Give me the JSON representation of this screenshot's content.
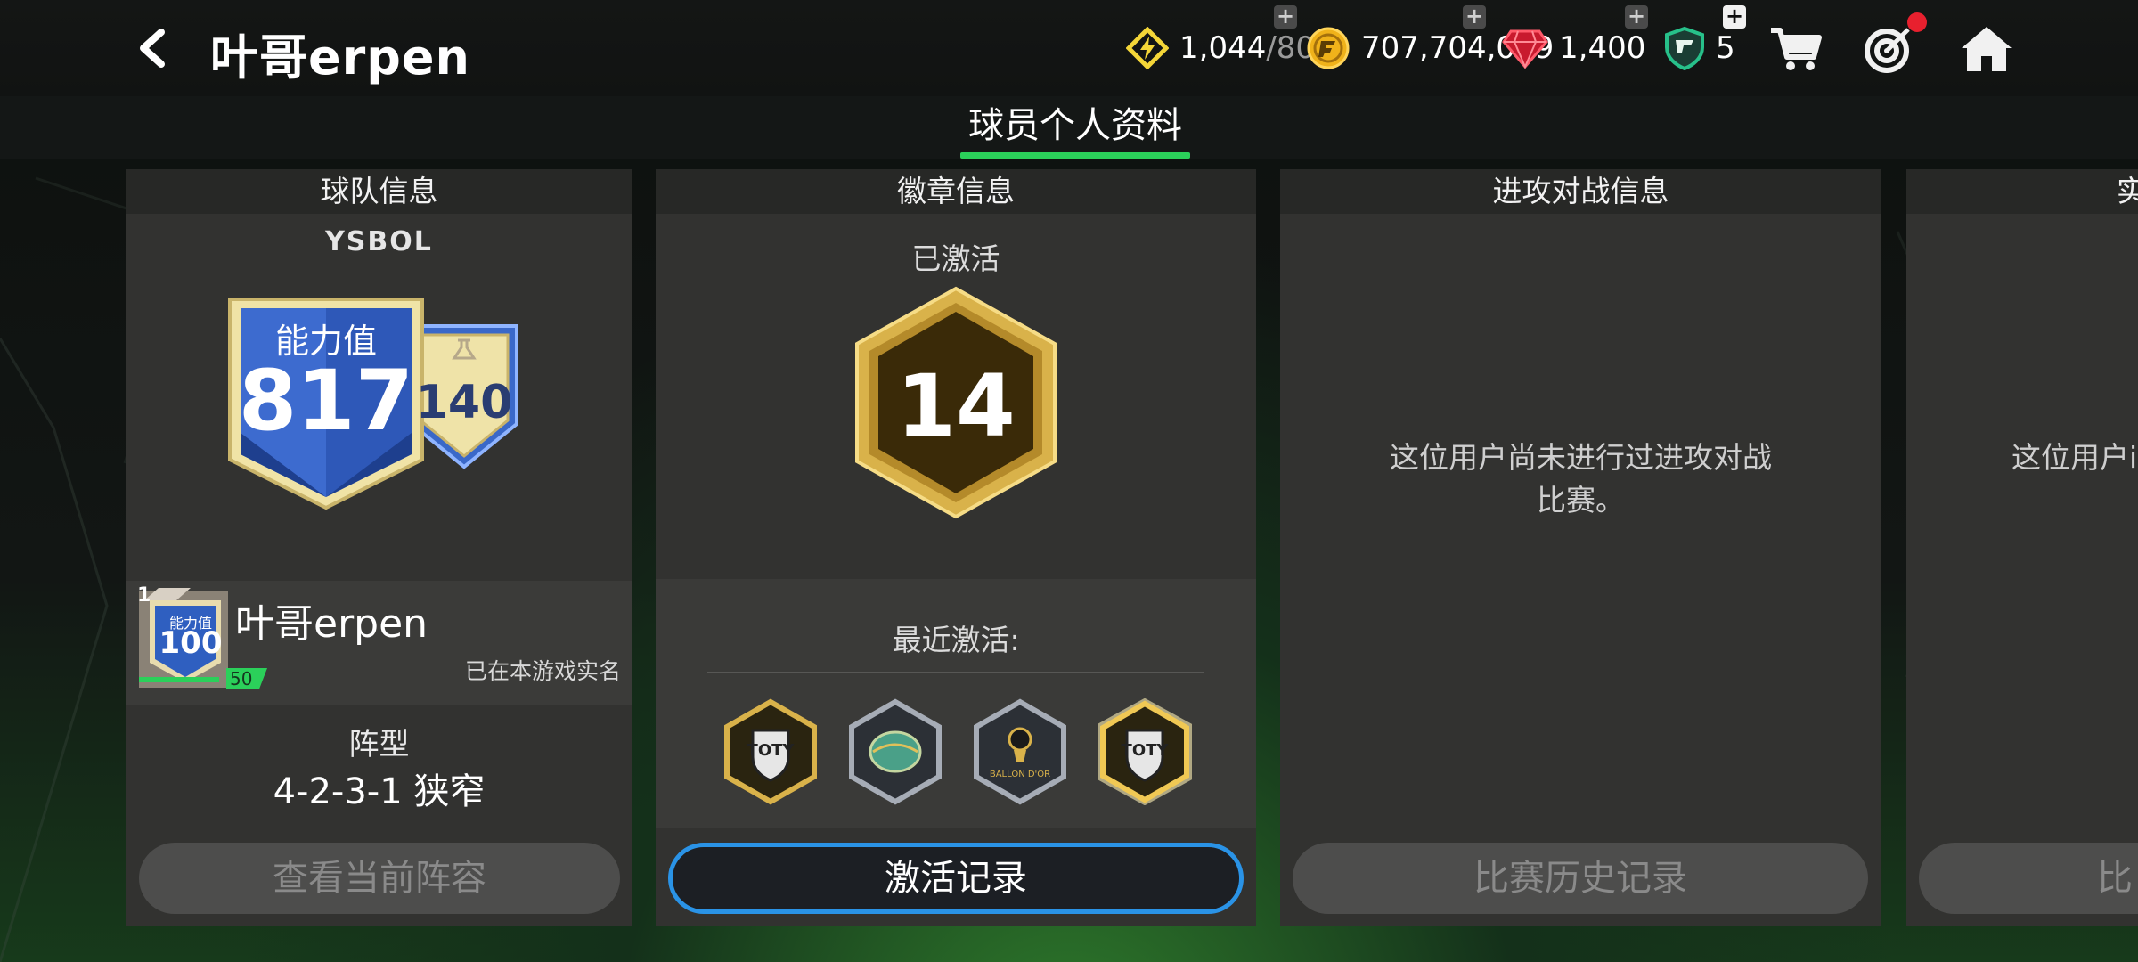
{
  "header": {
    "title": "叶哥erpen",
    "resources": [
      {
        "name": "energy",
        "value": "1,044",
        "suffix": "/80",
        "color": "#f4d638"
      },
      {
        "name": "fc-points-coin",
        "value": "707,704,079",
        "suffix": "",
        "color": "#f0b21a"
      },
      {
        "name": "gems",
        "value": "1,400",
        "suffix": "",
        "color": "#e3243a"
      },
      {
        "name": "tickets",
        "value": "5",
        "suffix": "",
        "color": "#27c08a"
      }
    ],
    "icons": [
      "back-icon",
      "cart-icon",
      "target-icon",
      "home-icon"
    ]
  },
  "subheader": {
    "active_tab": "球员个人资料"
  },
  "team_panel": {
    "heading": "球队信息",
    "team_name": "YSBOL",
    "ovr_label": "能力值",
    "ovr_value": "817",
    "bonus_value": "140",
    "player": {
      "rank": "1",
      "card_label": "能力值",
      "card_value": "100",
      "level": "50",
      "name": "叶哥erpen",
      "verified": "已在本游戏实名"
    },
    "formation_label": "阵型",
    "formation_value": "4-2-3-1 狭窄",
    "button": "查看当前阵容"
  },
  "badge_panel": {
    "heading": "徽章信息",
    "activated_label": "已激活",
    "badge_count": "14",
    "recent_label": "最近激活:",
    "recent_badges": [
      "toty-badge-gold",
      "planet-badge-silver",
      "ballon-dor-badge-silver",
      "toty-badge-gold-glow"
    ],
    "ballon_text": "BALLON D'OR",
    "toty_text": "TOTY",
    "button": "激活记录"
  },
  "attack_panel": {
    "heading": "进攻对战信息",
    "message_line1": "这位用户尚未进行过进攻对战",
    "message_line2": "比赛。",
    "button": "比赛历史记录"
  },
  "fourth_panel": {
    "heading": "实",
    "message": "这位用户i",
    "button": "比"
  }
}
